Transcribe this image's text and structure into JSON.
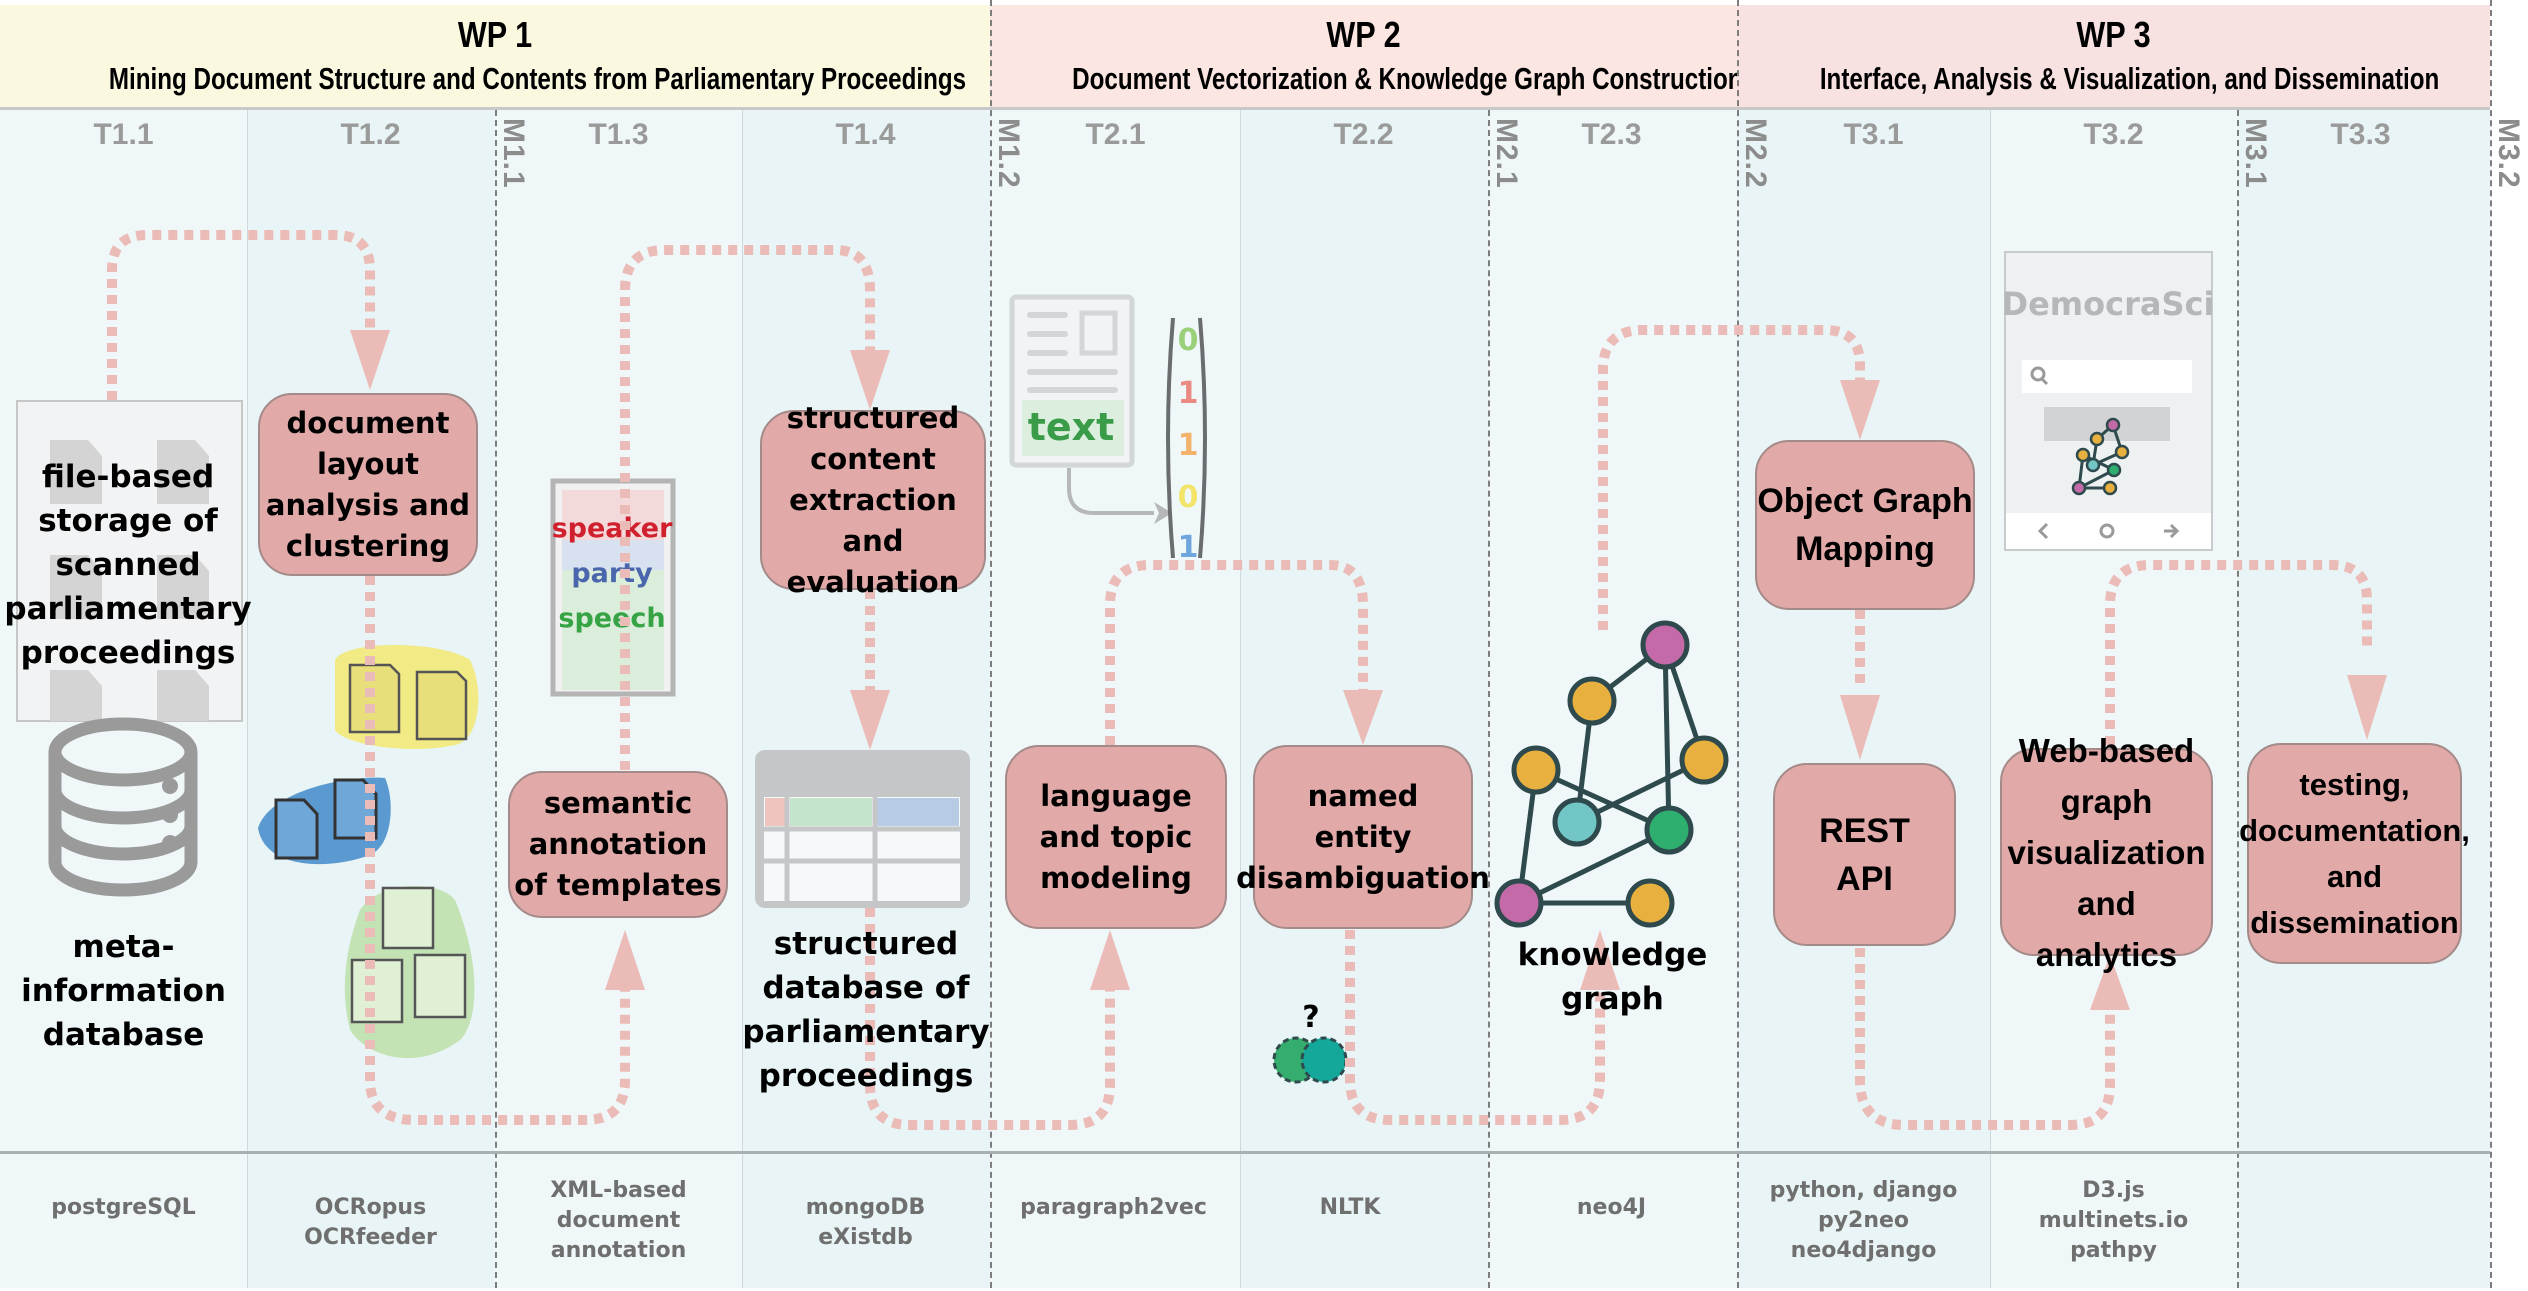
{
  "colors": {
    "wp1_bg": "#fbf8e0",
    "wp2_bg": "#fbe6e1",
    "wp3_bg": "#f7e1e1",
    "column_bg_a": "#eff7f9",
    "column_bg_b": "#e7f3f4",
    "task_box_fill": "#e1aaa8",
    "flow_arrow": "#ebbcb7",
    "node_purple": "#c46aa9",
    "node_yellow": "#e8b13f",
    "node_teal": "#72c6c6",
    "node_green": "#2eaf6f",
    "node_stroke": "#2e4a4d"
  },
  "work_packages": [
    {
      "id": "WP 1",
      "title": "Mining Document Structure and Contents from Parliamentary Proceedings"
    },
    {
      "id": "WP 2",
      "title": "Document Vectorization & Knowledge Graph Construction"
    },
    {
      "id": "WP 3",
      "title": "Interface, Analysis & Visualization, and Dissemination"
    }
  ],
  "tasks": [
    "T1.1",
    "T1.2",
    "T1.3",
    "T1.4",
    "T2.1",
    "T2.2",
    "T2.3",
    "T3.1",
    "T3.2",
    "T3.3"
  ],
  "milestones": [
    "M1.1",
    "M1.2",
    "M2.1",
    "M2.2",
    "M3.1",
    "M3.2"
  ],
  "process_boxes": {
    "doc_layout": "document\nlayout\nanalysis and\nclustering",
    "semantic_annotation": "semantic\nannotation\nof templates",
    "structured_content": "structured\ncontent\nextraction\nand\nevaluation",
    "language_topic": "language\nand topic\nmodeling",
    "ned": "named\nentity\ndisambiguation",
    "ogm": "Object Graph\nMapping",
    "rest_api": "REST\nAPI",
    "web_viz": "Web-based\ngraph\nvisualization\nand analytics",
    "testing": "testing,\ndocumentation,\nand\ndissemination"
  },
  "artifacts": {
    "file_storage": "file-based\nstorage of\nscanned\nparliamentary\nproceedings",
    "meta_db": "meta-\ninformation\ndatabase",
    "structured_db": "structured\ndatabase of\nparliamentary\nproceedings",
    "knowledge_graph": "knowledge\ngraph",
    "template_words": [
      "speaker",
      "party",
      "speech"
    ],
    "text_word": "text",
    "vector_digits": [
      "0",
      "1",
      "1",
      "0",
      "1"
    ],
    "question_mark": "?",
    "app_name": "DemocraSci"
  },
  "technologies": [
    "postgreSQL",
    "OCRopus\nOCRfeeder",
    "XML-based\ndocument\nannotation",
    "mongoDB\neXistdb",
    "paragraph2vec",
    "NLTK",
    "neo4J",
    "python, django\npy2neo\nneo4django",
    "D3.js\nmultinets.io\npathpy",
    ""
  ]
}
